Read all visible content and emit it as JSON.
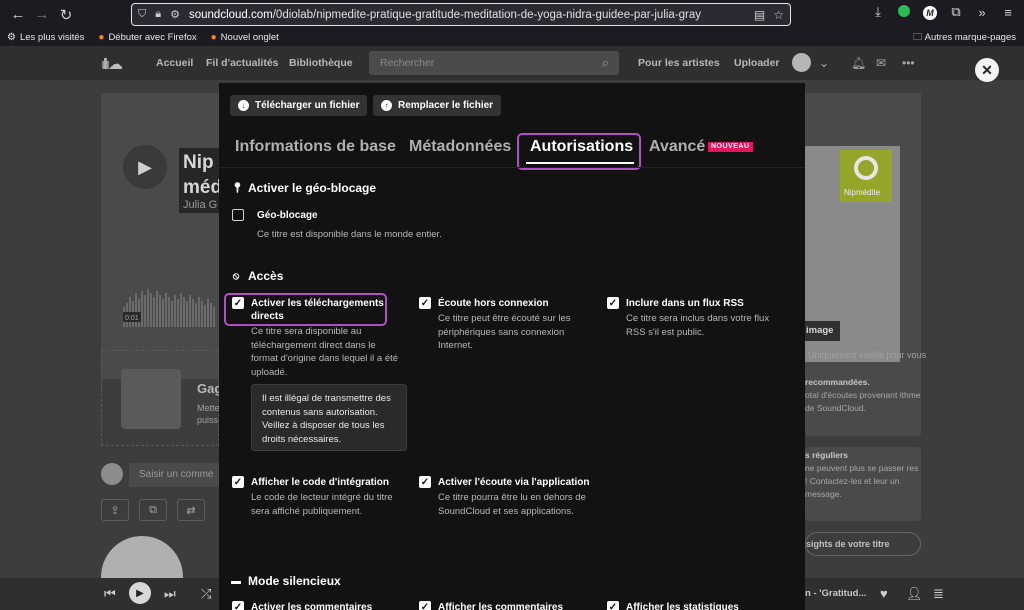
{
  "browser": {
    "url_host": "soundcloud.com",
    "url_path": "/0diolab/nipmedite-pratique-gratitude-meditation-de-yoga-nidra-guidee-par-julia-gray",
    "bookmarks": [
      {
        "label": "Les plus visités"
      },
      {
        "label": "Débuter avec Firefox"
      },
      {
        "label": "Nouvel onglet"
      }
    ],
    "other_bookmarks": "Autres marque-pages",
    "profile_letter": "M"
  },
  "sc": {
    "nav": [
      "Accueil",
      "Fil d'actualités",
      "Bibliothèque"
    ],
    "search_placeholder": "Rechercher",
    "for_artists": "Pour les artistes",
    "upload": "Uploader",
    "hero_title": "Nip méd",
    "hero_artist": "Julia G",
    "time": "0:01",
    "cover_text": "Nipmédite",
    "image_btn": "image",
    "visible_note": "Uniquement visible pour vous",
    "side_title": "Gag",
    "side_desc": "Mette puiss",
    "comment_placeholder": "Saisir un comme",
    "card1_title": "recommandées.",
    "card1_text": "otal d'écoutes provenant ithme de SoundCloud.",
    "card2_title": "s réguliers",
    "card2_text": "ne peuvent plus se passer res ! Contactez-les et leur un message.",
    "insights": "sights de votre titre",
    "player_title": "n - 'Gratitud..."
  },
  "modal": {
    "download_btn": "Télécharger un fichier",
    "replace_btn": "Remplacer le fichier",
    "tabs": [
      "Informations de base",
      "Métadonnées",
      "Autorisations",
      "Avancé"
    ],
    "new_badge": "NOUVEAU",
    "geo_section": "Activer le géo-blocage",
    "geo_label": "Géo-blocage",
    "geo_desc": "Ce titre est disponible dans le monde entier.",
    "access_section": "Accès",
    "options": [
      {
        "label": "Activer les téléchargements directs",
        "desc": "Ce titre sera disponible au téléchargement direct dans le format d'origine dans lequel il a été uploadé.",
        "checked": true
      },
      {
        "label": "Écoute hors connexion",
        "desc": "Ce titre peut être écouté sur les périphériques sans connexion Internet.",
        "checked": true
      },
      {
        "label": "Inclure dans un flux RSS",
        "desc": "Ce titre sera inclus dans votre flux RSS s'il est public.",
        "checked": true
      },
      {
        "label": "Afficher le code d'intégration",
        "desc": "Le code de lecteur intégré du titre sera affiché publiquement.",
        "checked": true
      },
      {
        "label": "Activer l'écoute via l'application",
        "desc": "Ce titre pourra être lu en dehors de SoundCloud et ses applications.",
        "checked": true
      }
    ],
    "warning": "Il est illégal de transmettre des contenus sans autorisation. Veillez à disposer de tous les droits nécessaires.",
    "silent_section": "Mode silencieux",
    "silent_options": [
      "Activer les commentaires",
      "Afficher les commentaires",
      "Afficher les statistiques"
    ]
  }
}
